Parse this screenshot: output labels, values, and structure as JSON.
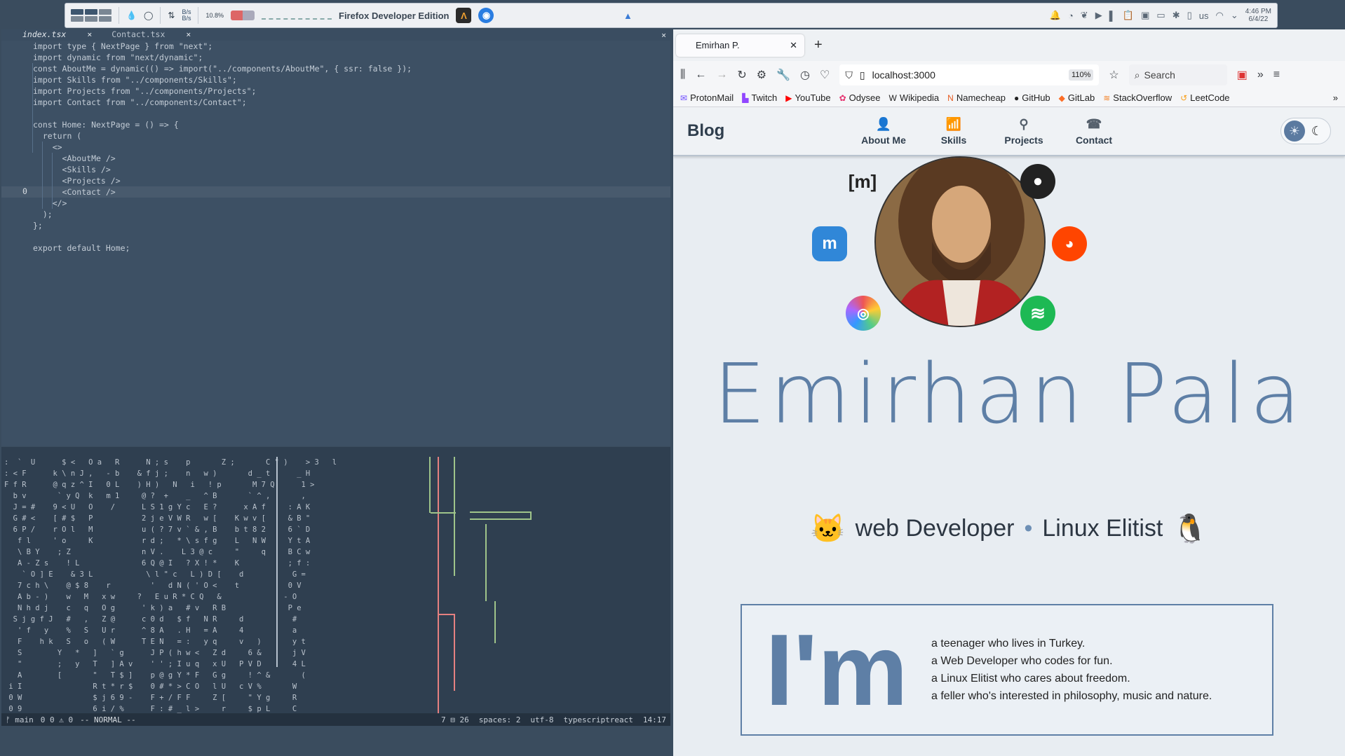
{
  "panel": {
    "net_up": "B/s",
    "net_down": "B/s",
    "cpu": "10.8%",
    "active_window_title": "Firefox Developer Edition",
    "keyboard_layout": "us",
    "time": "4:46 PM",
    "date": "6/4/22"
  },
  "editor": {
    "tabs": [
      {
        "label": "index.tsx",
        "active": true
      },
      {
        "label": "Contact.tsx",
        "active": false
      }
    ],
    "code_lines": [
      "import type { NextPage } from \"next\";",
      "import dynamic from \"next/dynamic\";",
      "const AboutMe = dynamic(() => import(\"../components/AboutMe\", { ssr: false });",
      "import Skills from \"../components/Skills\";",
      "import Projects from \"../components/Projects\";",
      "import Contact from \"../components/Contact\";",
      "",
      "const Home: NextPage = () => {",
      "  return (",
      "    <>",
      "      <AboutMe />",
      "      <Skills />",
      "      <Projects />",
      "      <Contact />",
      "    </>",
      "  );",
      "};",
      "",
      "export default Home;"
    ],
    "cursor_line_number": "0"
  },
  "statusline": {
    "branch": "main",
    "diagnostics": "0 0 ⚠ 0",
    "mode": "-- NORMAL --",
    "info": "7 ⊟ 26",
    "spaces": "spaces: 2",
    "encoding": "utf-8",
    "filetype": "typescriptreact",
    "position": "14:17"
  },
  "browser": {
    "tab_title": "Emirhan P.",
    "url": "localhost:3000",
    "zoom": "110%",
    "search_placeholder": "Search",
    "bookmarks": [
      "ProtonMail",
      "Twitch",
      "YouTube",
      "Odysee",
      "Wikipedia",
      "Namecheap",
      "GitHub",
      "GitLab",
      "StackOverflow",
      "LeetCode"
    ]
  },
  "site": {
    "brand": "Blog",
    "nav": [
      "About Me",
      "Skills",
      "Projects",
      "Contact"
    ],
    "name": "Emirhan Pala",
    "role1": "web Developer",
    "separator": "•",
    "role2": "Linux Elitist",
    "im": "I'm",
    "facts": [
      "a teenager who lives in Turkey.",
      "a Web Developer who codes for fun.",
      "a Linux Elitist who cares about freedom.",
      "a feller who's interested in philosophy, music and nature."
    ],
    "matrix_icon_text": "[m]"
  },
  "colors": {
    "accent": "#5e7fa6",
    "editor_bg": "#3d5064",
    "terminal_bg": "#2f3f50"
  }
}
